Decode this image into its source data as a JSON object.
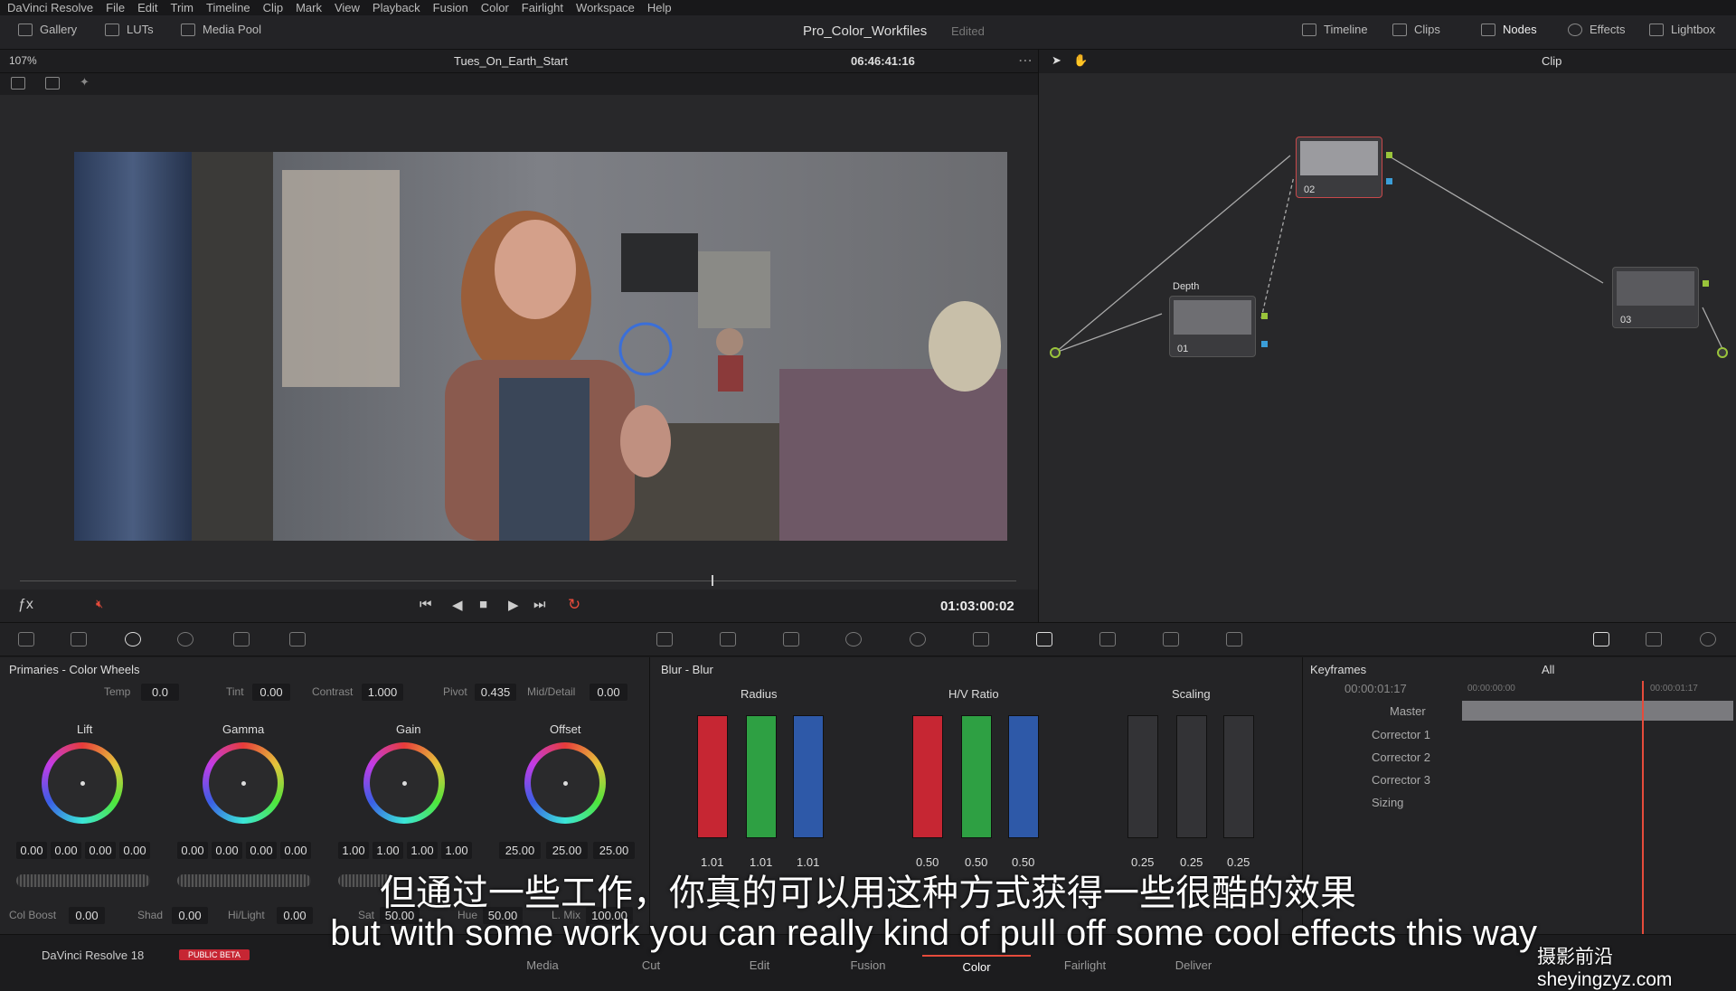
{
  "menu": [
    "DaVinci Resolve",
    "File",
    "Edit",
    "Trim",
    "Timeline",
    "Clip",
    "Mark",
    "View",
    "Playback",
    "Fusion",
    "Color",
    "Fairlight",
    "Workspace",
    "Help"
  ],
  "topbar": {
    "gallery": "Gallery",
    "luts": "LUTs",
    "media_pool": "Media Pool",
    "project": "Pro_Color_Workfiles",
    "status": "Edited",
    "timeline": "Timeline",
    "clips": "Clips",
    "nodes": "Nodes",
    "effects": "Effects",
    "lightbox": "Lightbox"
  },
  "viewer": {
    "zoom": "107%",
    "clip_name": "Tues_On_Earth_Start",
    "timecode": "06:46:41:16",
    "playhead_tc": "01:03:00:02",
    "clip_mode": "Clip"
  },
  "nodes": {
    "depth_label": "Depth",
    "n1": "01",
    "n2": "02",
    "n3": "03"
  },
  "primaries": {
    "title": "Primaries - Color Wheels",
    "temp_label": "Temp",
    "temp": "0.0",
    "tint_label": "Tint",
    "tint": "0.00",
    "contrast_label": "Contrast",
    "contrast": "1.000",
    "pivot_label": "Pivot",
    "pivot": "0.435",
    "middetail_label": "Mid/Detail",
    "middetail": "0.00",
    "wheels": [
      {
        "name": "Lift",
        "values": [
          "0.00",
          "0.00",
          "0.00",
          "0.00"
        ]
      },
      {
        "name": "Gamma",
        "values": [
          "0.00",
          "0.00",
          "0.00",
          "0.00"
        ]
      },
      {
        "name": "Gain",
        "values": [
          "1.00",
          "1.00",
          "1.00",
          "1.00"
        ]
      },
      {
        "name": "Offset",
        "values": [
          "25.00",
          "25.00",
          "25.00"
        ]
      }
    ],
    "colboost_label": "Col Boost",
    "colboost": "0.00",
    "shad_label": "Shad",
    "shad": "0.00",
    "hilight_label": "Hi/Light",
    "hilight": "0.00",
    "sat_label": "Sat",
    "sat": "50.00",
    "hue_label": "Hue",
    "hue": "50.00",
    "lmix_label": "L. Mix",
    "lmix": "100.00"
  },
  "blur": {
    "title": "Blur - Blur",
    "radius_label": "Radius",
    "radius": [
      "1.01",
      "1.01",
      "1.01"
    ],
    "hv_label": "H/V Ratio",
    "hv": [
      "0.50",
      "0.50",
      "0.50"
    ],
    "scaling_label": "Scaling",
    "scaling": [
      "0.25",
      "0.25",
      "0.25"
    ]
  },
  "keyframes": {
    "title": "Keyframes",
    "filter": "All",
    "tc": "00:00:01:17",
    "start": "00:00:00:00",
    "end": "00:00:01:17",
    "rows": [
      "Master",
      "Corrector 1",
      "Corrector 2",
      "Corrector 3",
      "Sizing"
    ]
  },
  "bottom": {
    "app": "DaVinci Resolve 18",
    "beta": "PUBLIC BETA",
    "pages": [
      "Media",
      "Cut",
      "Edit",
      "Fusion",
      "Color",
      "Fairlight",
      "Deliver"
    ],
    "active_page": "Color"
  },
  "subtitles": {
    "zh": "但通过一些工作，你真的可以用这种方式获得一些很酷的效果",
    "en": "but with some work you can really kind of pull off some cool effects this way",
    "watermark": "摄影前沿 sheyingzyz.com"
  },
  "colors": {
    "accent": "#e64b3b",
    "red": "#c62633",
    "green": "#2ea043",
    "blue": "#2e59a8"
  }
}
